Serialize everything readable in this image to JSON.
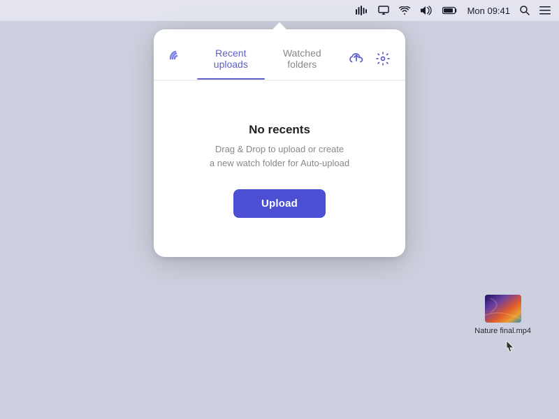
{
  "menubar": {
    "time": "Mon 09:41",
    "icons": {
      "sound_waves": "sound-waves-icon",
      "airplay": "airplay-icon",
      "wifi": "wifi-icon",
      "volume": "volume-icon",
      "battery": "battery-icon",
      "search": "search-icon",
      "menu": "menu-icon"
    }
  },
  "popup": {
    "tabs": [
      {
        "id": "recent-uploads",
        "label": "Recent uploads",
        "active": true
      },
      {
        "id": "watched-folders",
        "label": "Watched folders",
        "active": false
      }
    ],
    "actions": {
      "upload_cloud": "upload-cloud-icon",
      "settings": "settings-icon"
    },
    "empty_state": {
      "title": "No recents",
      "description_line1": "Drag & Drop to upload or create",
      "description_line2": "a new watch folder for Auto-upload"
    },
    "upload_button_label": "Upload"
  },
  "desktop": {
    "file": {
      "name": "Nature final.mp4",
      "thumbnail_alt": "video thumbnail"
    }
  }
}
